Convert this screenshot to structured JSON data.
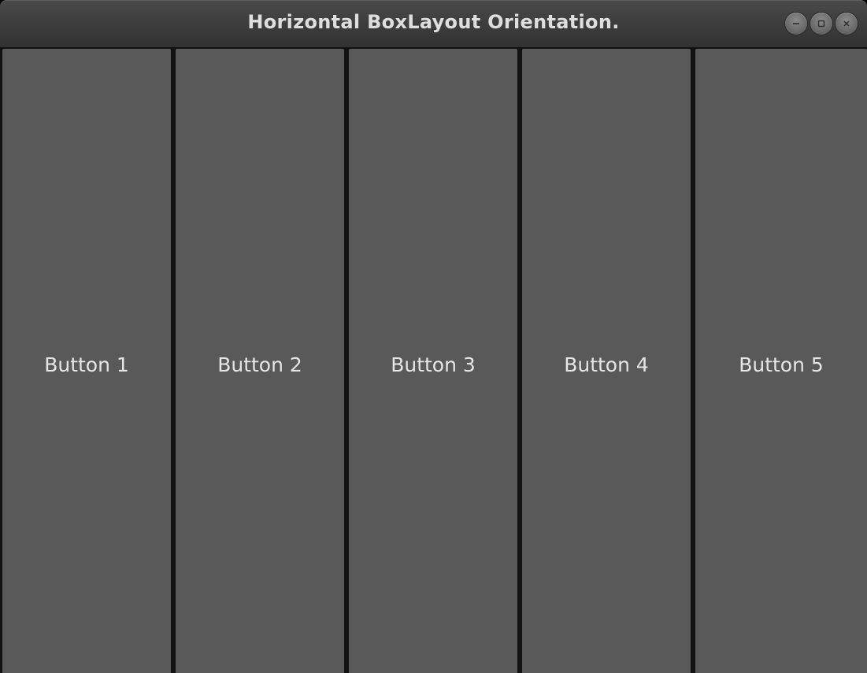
{
  "window": {
    "title": "Horizontal BoxLayout Orientation."
  },
  "title_buttons": [
    {
      "name": "minimize",
      "icon": "minimize-icon"
    },
    {
      "name": "maximize",
      "icon": "maximize-icon"
    },
    {
      "name": "close",
      "icon": "close-icon"
    }
  ],
  "buttons": [
    {
      "label": "Button 1"
    },
    {
      "label": "Button 2"
    },
    {
      "label": "Button 3"
    },
    {
      "label": "Button 4"
    },
    {
      "label": "Button 5"
    }
  ],
  "colors": {
    "titlebar": "#3c3c3c",
    "title_text": "#dedede",
    "button_bg": "#595959",
    "button_text": "#e6e6e6",
    "separator": "#121212"
  }
}
